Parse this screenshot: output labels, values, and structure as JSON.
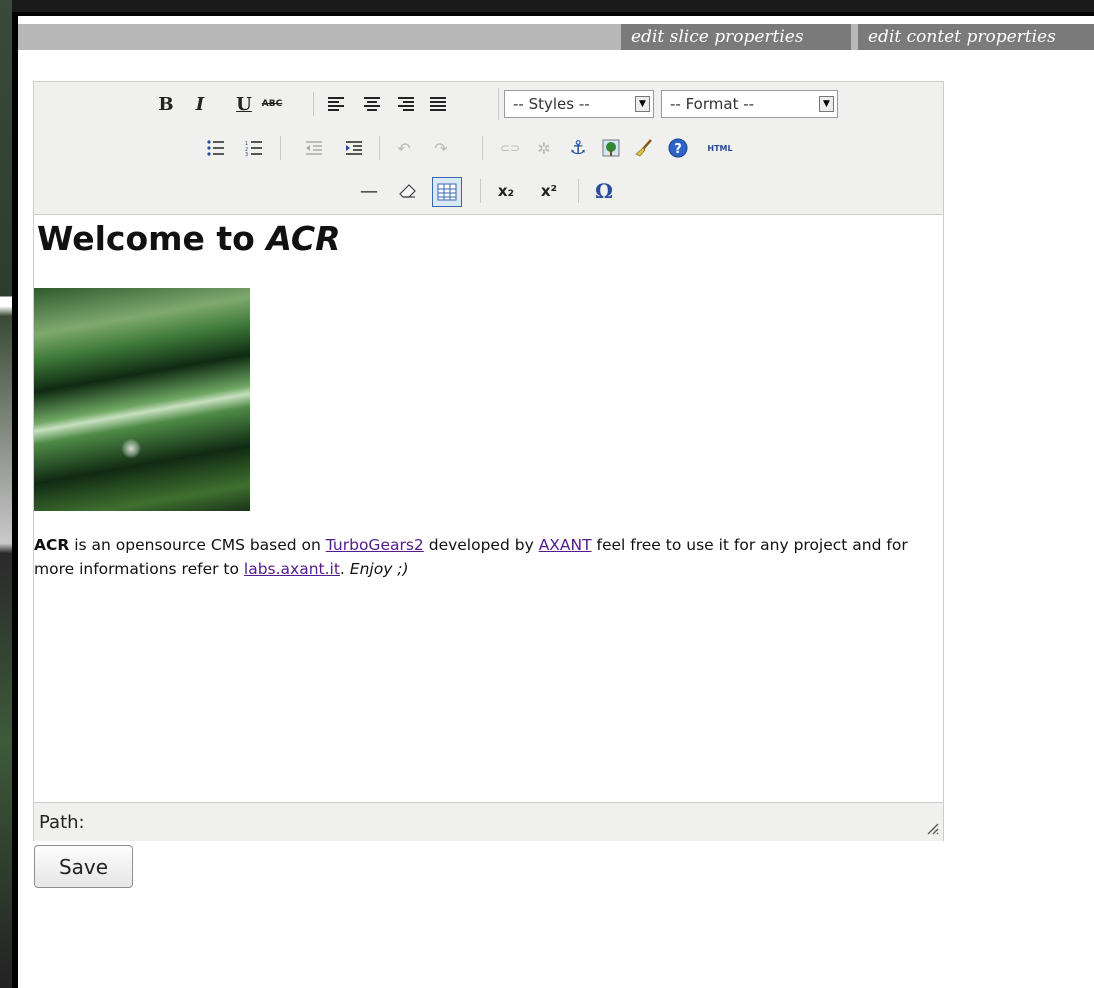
{
  "tabs": [
    {
      "label": "edit slice properties"
    },
    {
      "label": "edit contet properties"
    }
  ],
  "toolbar": {
    "bold": "B",
    "italic": "I",
    "underline": "U",
    "strike": "ABC",
    "styles_select": "-- Styles --",
    "format_select": "-- Format --",
    "html_button": "HTML",
    "subscript": "x₂",
    "superscript": "x²",
    "omega": "Ω"
  },
  "document": {
    "heading_prefix": "Welcome to ",
    "heading_emph": "ACR",
    "para_bold": "ACR",
    "para_text1": " is an opensource CMS based on ",
    "link1": "TurboGears2",
    "para_text2": " developed by ",
    "link2": "AXANT",
    "para_text3": " feel free to use it for any project and for more informations refer to ",
    "link3": "labs.axant.it",
    "para_text4": ". ",
    "para_em": "Enjoy ;)"
  },
  "statusbar": {
    "path_label": "Path:"
  },
  "save_button": "Save"
}
